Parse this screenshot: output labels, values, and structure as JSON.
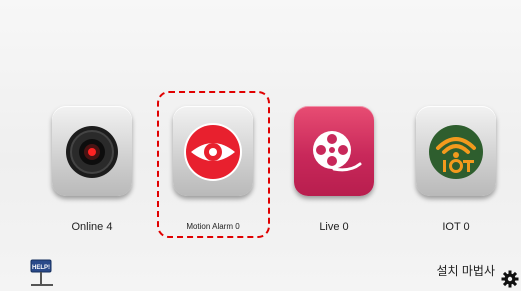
{
  "tiles": [
    {
      "label": "Online 4",
      "icon": "record-lens-icon"
    },
    {
      "label": "Motion Alarm 0",
      "icon": "eye-icon"
    },
    {
      "label": "Live 0",
      "icon": "film-reel-icon"
    },
    {
      "label": "IOT 0",
      "icon": "iot-wifi-icon"
    }
  ],
  "bottom": {
    "help_sign": "HELP!",
    "setup_wizard": "설치 마법사",
    "settings_icon": "gear-icon"
  },
  "colors": {
    "selection": "#e00000",
    "live_tile": "#c8285a",
    "iot_circle": "#2e5e2e",
    "iot_accent": "#f39a1d"
  }
}
